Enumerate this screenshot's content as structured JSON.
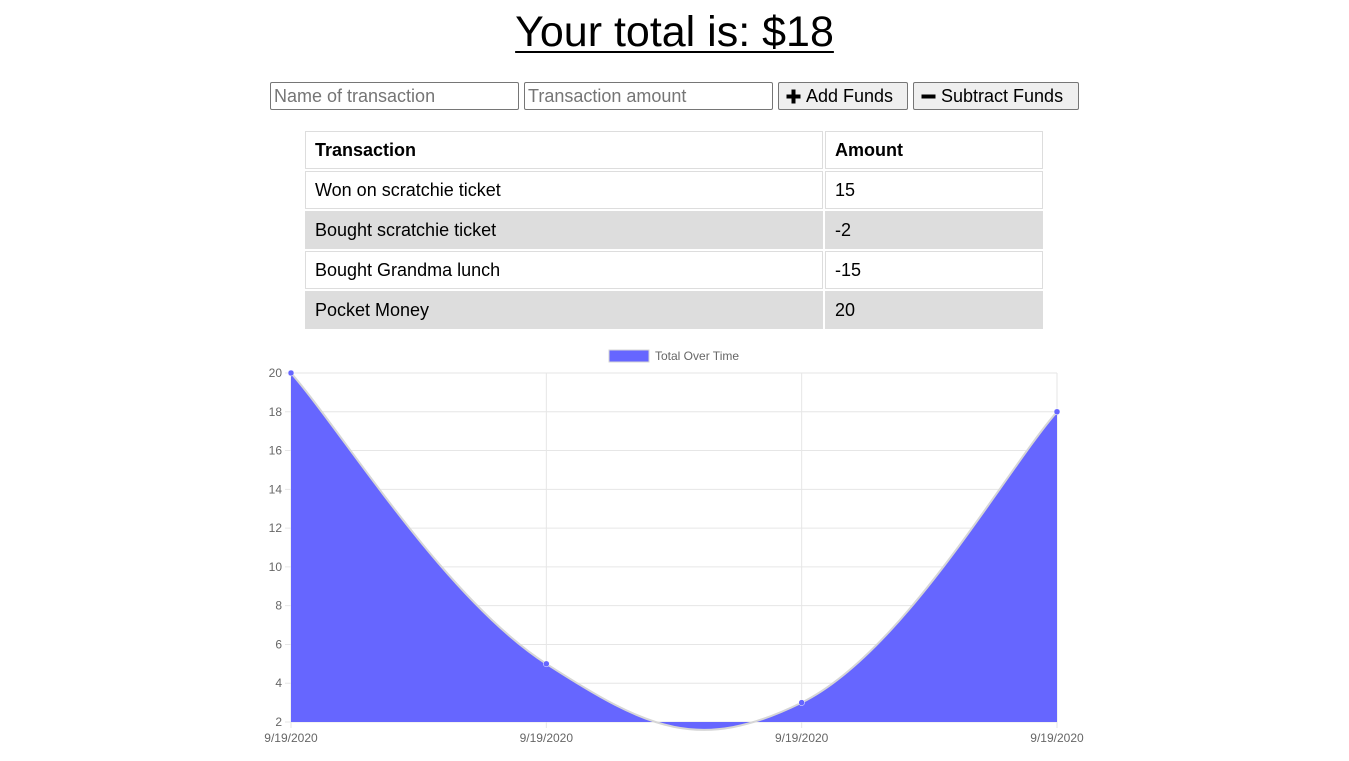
{
  "header": {
    "total_text": "Your total is: $18"
  },
  "form": {
    "name_placeholder": "Name of transaction",
    "amount_placeholder": "Transaction amount",
    "name_value": "",
    "amount_value": "",
    "add_label": "Add Funds",
    "subtract_label": "Subtract Funds",
    "add_icon": "plus-icon",
    "subtract_icon": "minus-icon"
  },
  "table": {
    "headers": [
      "Transaction",
      "Amount"
    ],
    "rows": [
      [
        "Won on scratchie ticket",
        "15"
      ],
      [
        "Bought scratchie ticket",
        "-2"
      ],
      [
        "Bought Grandma lunch",
        "-15"
      ],
      [
        "Pocket Money",
        "20"
      ]
    ]
  },
  "colors": {
    "fill": "#6666ff",
    "grid": "#e6e6e6",
    "tick_text": "#666666",
    "row_shade": "#dddddd"
  },
  "chart_data": {
    "type": "area",
    "title": "",
    "xlabel": "",
    "ylabel": "",
    "categories": [
      "9/19/2020",
      "9/19/2020",
      "9/19/2020",
      "9/19/2020"
    ],
    "series": [
      {
        "name": "Total Over Time",
        "values": [
          20,
          5,
          3,
          18
        ]
      }
    ],
    "ylim": [
      2,
      20
    ],
    "yticks": [
      2,
      4,
      6,
      8,
      10,
      12,
      14,
      16,
      18,
      20
    ],
    "grid": true,
    "legend": "top-center"
  }
}
